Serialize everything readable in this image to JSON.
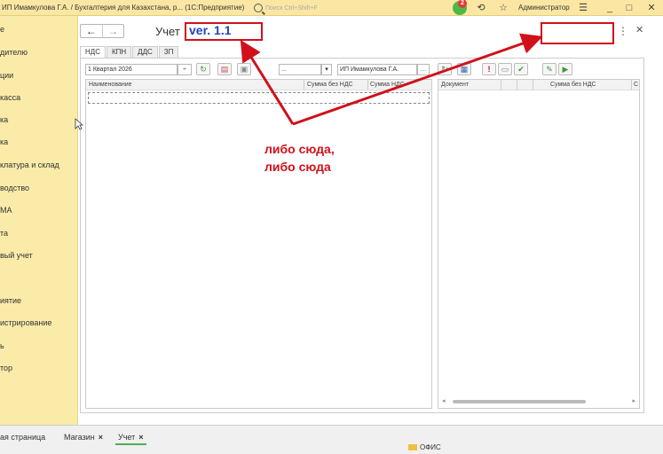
{
  "titlebar": {
    "title": "ИП Имамкулова Г.А. / Бухгалтерия для Казахстана, р... (1С:Предприятие)",
    "search_placeholder": "Поиск Ctrl+Shift+F",
    "notifications_count": "2",
    "user": "Администратор"
  },
  "sidebar": {
    "items": [
      "е",
      "дителю",
      "ции",
      " касса",
      "ка",
      "ка",
      "клатура и склад",
      "водство",
      "МА",
      "та",
      "вый учет",
      "",
      "иятие",
      "истрирование",
      "ь",
      "тор"
    ]
  },
  "main": {
    "title": "Учет",
    "version": "ver. 1.1",
    "tabs": [
      "НДС",
      "КПН",
      "ДДС",
      "ЗП"
    ],
    "period": "1 Квартал 2026",
    "dots_field": "...",
    "org": "ИП Имамкулова Г.А.",
    "left_grid": {
      "columns": [
        "Наименование",
        "Сумма без НДС",
        "Сумма НДС"
      ]
    },
    "right_grid": {
      "columns": [
        "Документ",
        "Сумма без НДС",
        "С"
      ]
    },
    "annotation_line1": "либо сюда,",
    "annotation_line2": "либо сюда"
  },
  "bottom_tabs": [
    {
      "label": "ая страница"
    },
    {
      "label": "Магазин"
    },
    {
      "label": "Учет"
    }
  ],
  "folder": "ОФИС",
  "colors": {
    "accent_red": "#d0101b",
    "version_blue": "#2244bb",
    "sidebar_bg": "#fbeba9"
  }
}
